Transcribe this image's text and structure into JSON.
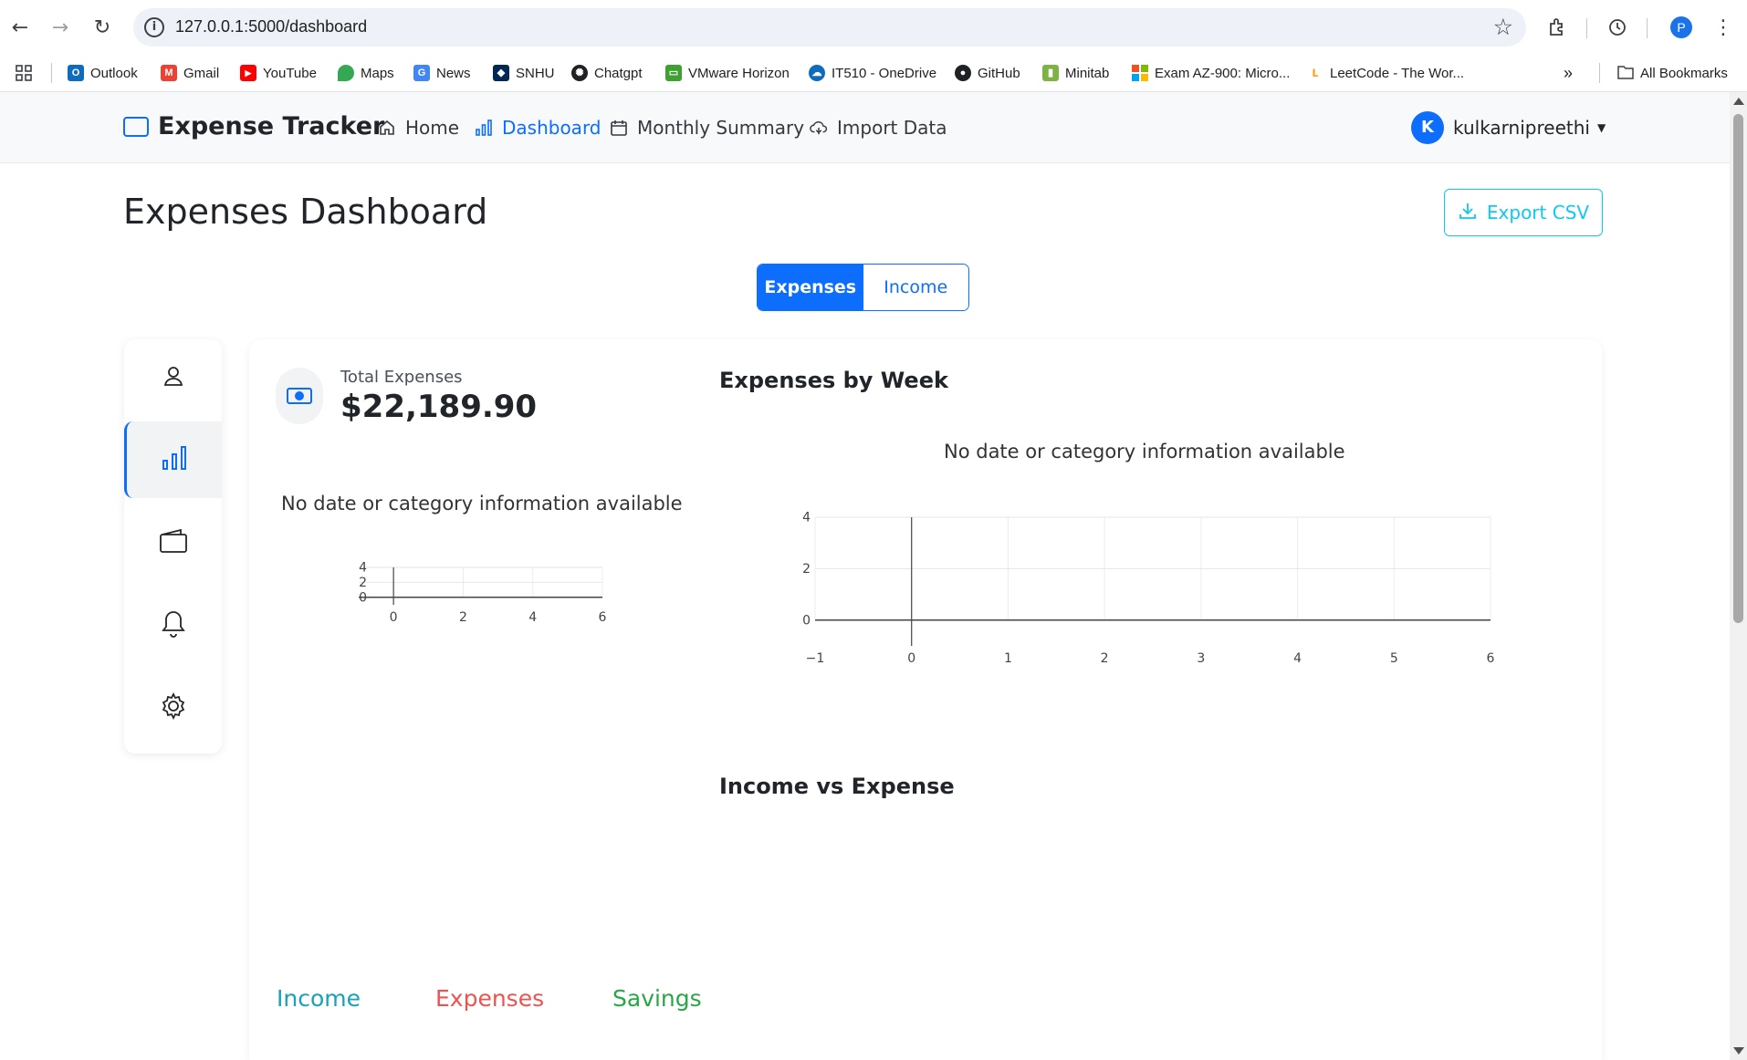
{
  "browser": {
    "url": "127.0.0.1:5000/dashboard",
    "profile_initial": "P",
    "bookmarks": [
      {
        "label": "Outlook",
        "color": "#0f6cbd",
        "glyph": "O"
      },
      {
        "label": "Gmail",
        "color": "#ea4335",
        "glyph": "M"
      },
      {
        "label": "YouTube",
        "color": "#ff0000",
        "glyph": "▶"
      },
      {
        "label": "Maps",
        "color": "#34a853",
        "glyph": "●"
      },
      {
        "label": "News",
        "color": "#4285f4",
        "glyph": "G"
      },
      {
        "label": "SNHU",
        "color": "#002855",
        "glyph": "◆"
      },
      {
        "label": "Chatgpt",
        "color": "#202124",
        "glyph": "✺"
      },
      {
        "label": "VMware Horizon",
        "color": "#3ca12f",
        "glyph": "▭"
      },
      {
        "label": "IT510 - OneDrive",
        "color": "#0f6cbd",
        "glyph": "☁"
      },
      {
        "label": "GitHub",
        "color": "#202124",
        "glyph": "●"
      },
      {
        "label": "Minitab",
        "color": "#7cb342",
        "glyph": "▮"
      },
      {
        "label": "Exam AZ-900: Micro...",
        "color": "#f25022",
        "glyph": "■"
      },
      {
        "label": "LeetCode - The Wor...",
        "color": "#ffa116",
        "glyph": "L"
      }
    ],
    "all_bookmarks": "All Bookmarks"
  },
  "app": {
    "brand": "Expense Tracker",
    "nav": {
      "home": "Home",
      "dashboard": "Dashboard",
      "monthly": "Monthly Summary",
      "import": "Import Data"
    },
    "user": {
      "initial": "K",
      "name": "kulkarnipreethi"
    }
  },
  "page": {
    "title": "Expenses Dashboard",
    "export_label": "Export CSV",
    "toggle": {
      "expenses": "Expenses",
      "income": "Income"
    },
    "total_label": "Total Expenses",
    "total_value": "$22,189.90",
    "no_info_left": "No date or category information available",
    "weekly_title": "Expenses by Week",
    "no_info_right": "No date or category information available",
    "ive_title": "Income vs Expense",
    "legend": {
      "income": "Income",
      "expenses": "Expenses",
      "savings": "Savings"
    }
  },
  "colors": {
    "primary": "#0d6efd",
    "info": "#0dcaf0",
    "income": "#17a2b8",
    "expenses": "#ef5350",
    "savings": "#28a745"
  },
  "chart_data": [
    {
      "type": "line",
      "title": "",
      "x_ticks": [
        "0",
        "2",
        "4",
        "6"
      ],
      "y_ticks": [
        "0",
        "2",
        "4"
      ],
      "xlim": [
        -1,
        6
      ],
      "ylim": [
        -1,
        4
      ],
      "series": []
    },
    {
      "type": "line",
      "title": "",
      "x_ticks": [
        "−1",
        "0",
        "1",
        "2",
        "3",
        "4",
        "5",
        "6"
      ],
      "y_ticks": [
        "0",
        "2",
        "4"
      ],
      "xlim": [
        -1,
        6
      ],
      "ylim": [
        -1,
        4
      ],
      "series": []
    }
  ]
}
